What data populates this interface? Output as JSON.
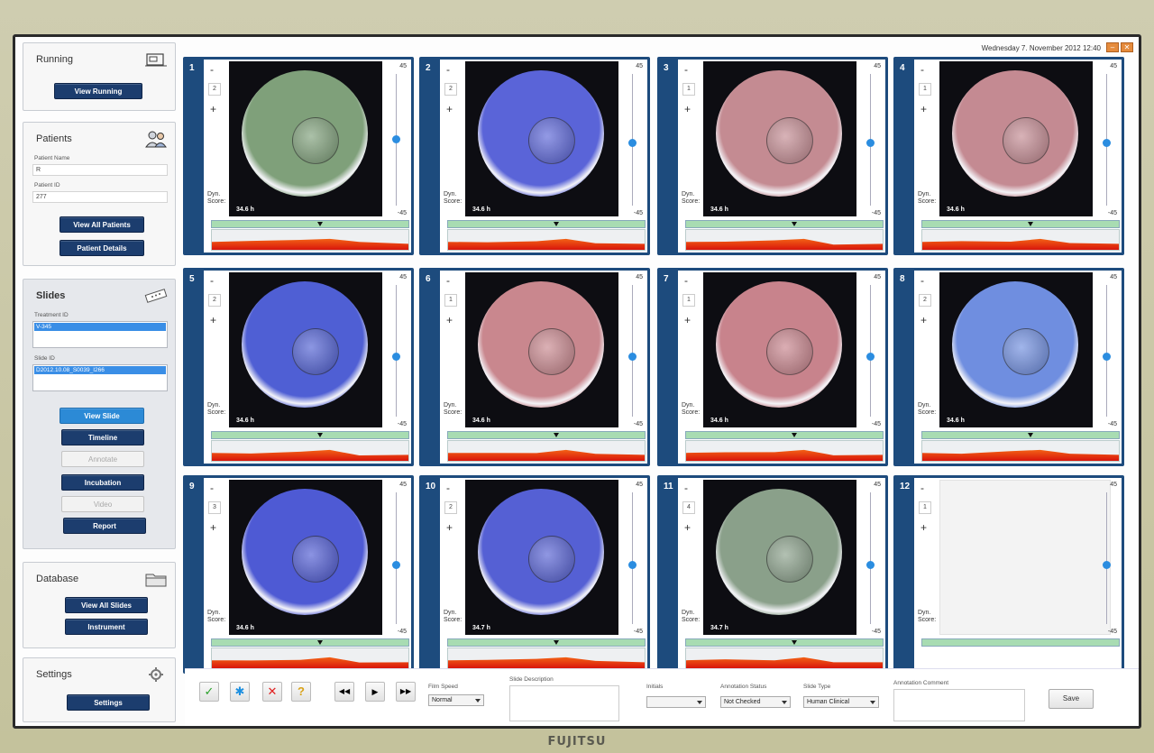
{
  "header": {
    "datetime": "Wednesday 7. November 2012  12:40"
  },
  "sidebar": {
    "running": {
      "title": "Running",
      "button": "View Running"
    },
    "patients": {
      "title": "Patients",
      "name_label": "Patient Name",
      "name_value": "R",
      "id_label": "Patient ID",
      "id_value": "277",
      "buttons": [
        "View All Patients",
        "Patient Details"
      ]
    },
    "slides": {
      "title": "Slides",
      "treatment_label": "Treatment ID",
      "treatment_value": "V-345",
      "slide_label": "Slide ID",
      "slide_value": "D2012.10.08_S0039_I266",
      "buttons": [
        "View Slide",
        "Timeline",
        "Annotate",
        "Incubation",
        "Video",
        "Report"
      ]
    },
    "database": {
      "title": "Database",
      "buttons": [
        "View All Slides",
        "Instrument"
      ]
    },
    "settings": {
      "title": "Settings",
      "button": "Settings"
    }
  },
  "wells": [
    {
      "num": "1",
      "count": "2",
      "time": "34.6 h",
      "color": "#7fa07a",
      "knob": 0.49,
      "marker": 0.55
    },
    {
      "num": "2",
      "count": "2",
      "time": "34.6 h",
      "color": "#5a64d8",
      "knob": 0.52,
      "marker": 0.55
    },
    {
      "num": "3",
      "count": "1",
      "time": "34.6 h",
      "color": "#c48b92",
      "knob": 0.52,
      "marker": 0.55
    },
    {
      "num": "4",
      "count": "1",
      "time": "34.6 h",
      "color": "#c48a92",
      "knob": 0.52,
      "marker": 0.55
    },
    {
      "num": "5",
      "count": "2",
      "time": "34.6 h",
      "color": "#4f5fd4",
      "knob": 0.54,
      "marker": 0.55
    },
    {
      "num": "6",
      "count": "1",
      "time": "34.6 h",
      "color": "#c9878e",
      "knob": 0.54,
      "marker": 0.55
    },
    {
      "num": "7",
      "count": "1",
      "time": "34.6 h",
      "color": "#c8838c",
      "knob": 0.54,
      "marker": 0.55
    },
    {
      "num": "8",
      "count": "2",
      "time": "34.6 h",
      "color": "#6f8ee0",
      "knob": 0.54,
      "marker": 0.55
    },
    {
      "num": "9",
      "count": "3",
      "time": "34.6 h",
      "color": "#4e5ad4",
      "knob": 0.55,
      "marker": 0.55
    },
    {
      "num": "10",
      "count": "2",
      "time": "34.7 h",
      "color": "#5560d4",
      "knob": 0.55,
      "marker": 0.55
    },
    {
      "num": "11",
      "count": "4",
      "time": "34.7 h",
      "color": "#8aa08a",
      "knob": 0.55,
      "marker": 0.55
    },
    {
      "num": "12",
      "count": "1",
      "time": "",
      "color": "",
      "knob": 0.55,
      "marker": 0
    }
  ],
  "scale": {
    "top": "45",
    "bottom": "-45"
  },
  "well_labels": {
    "minus": "-",
    "plus": "+",
    "dyn_score": "Dyn.\nScore:"
  },
  "toolbar": {
    "icons": [
      "✓",
      "✱",
      "✕",
      "?"
    ],
    "media": [
      "◀◀",
      "▶",
      "▶▶"
    ],
    "film_speed_label": "Film Speed",
    "film_speed_value": "Normal",
    "slide_description_label": "Slide Description",
    "initials_label": "Initials",
    "annotation_status_label": "Annotation Status",
    "annotation_status_value": "Not Checked",
    "slide_type_label": "Slide Type",
    "slide_type_value": "Human Clinical",
    "annotation_comment_label": "Annotation Comment",
    "save_label": "Save"
  },
  "monitor_brand": "FUJITSU"
}
